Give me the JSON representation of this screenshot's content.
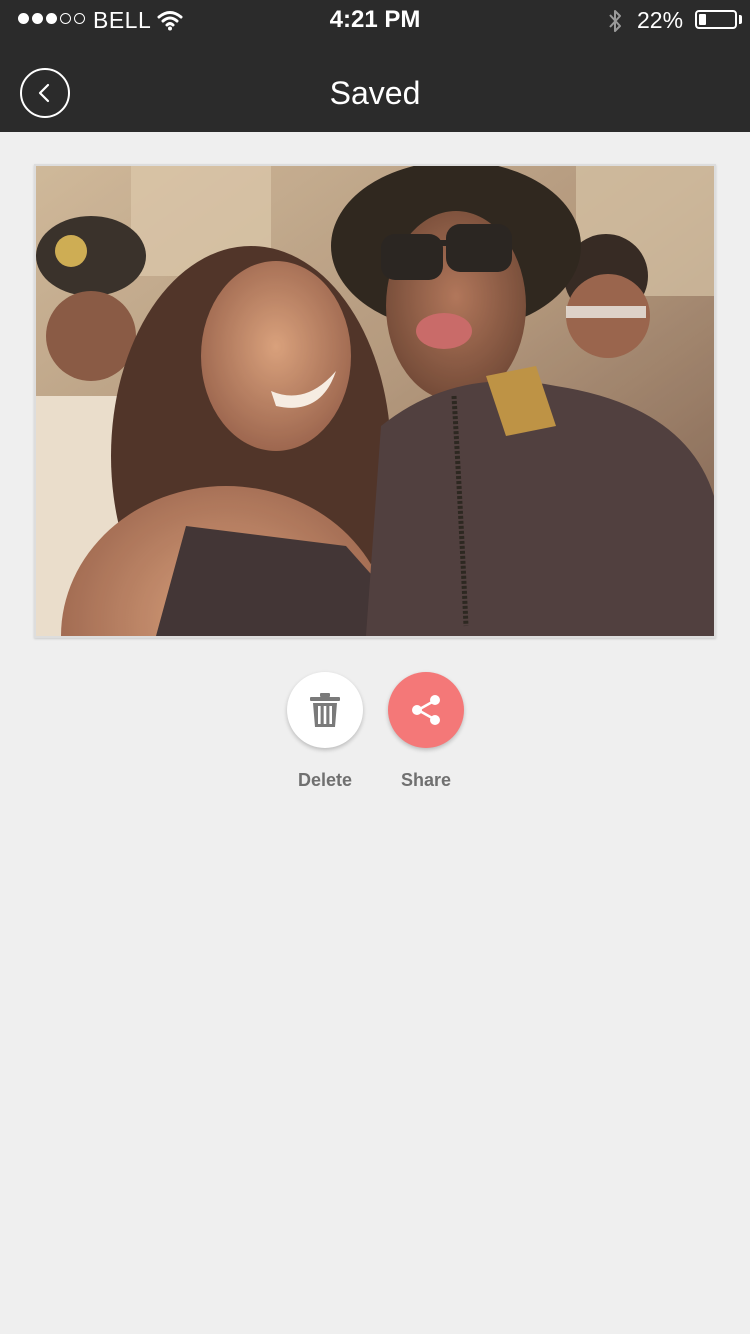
{
  "status_bar": {
    "signal_filled": 3,
    "signal_total": 5,
    "carrier": "BELL",
    "time": "4:21 PM",
    "battery_percent_text": "22%",
    "battery_level": 0.22
  },
  "nav": {
    "title": "Saved",
    "back_icon": "chevron-left-icon"
  },
  "photo": {
    "description_icon": "saved-photo"
  },
  "actions": {
    "delete_label": "Delete",
    "share_label": "Share",
    "delete_icon": "trash-icon",
    "share_icon": "share-icon"
  },
  "colors": {
    "bar_background": "#2b2b2b",
    "page_background": "#efefef",
    "share_accent": "#f47878",
    "label_gray": "#707070"
  }
}
